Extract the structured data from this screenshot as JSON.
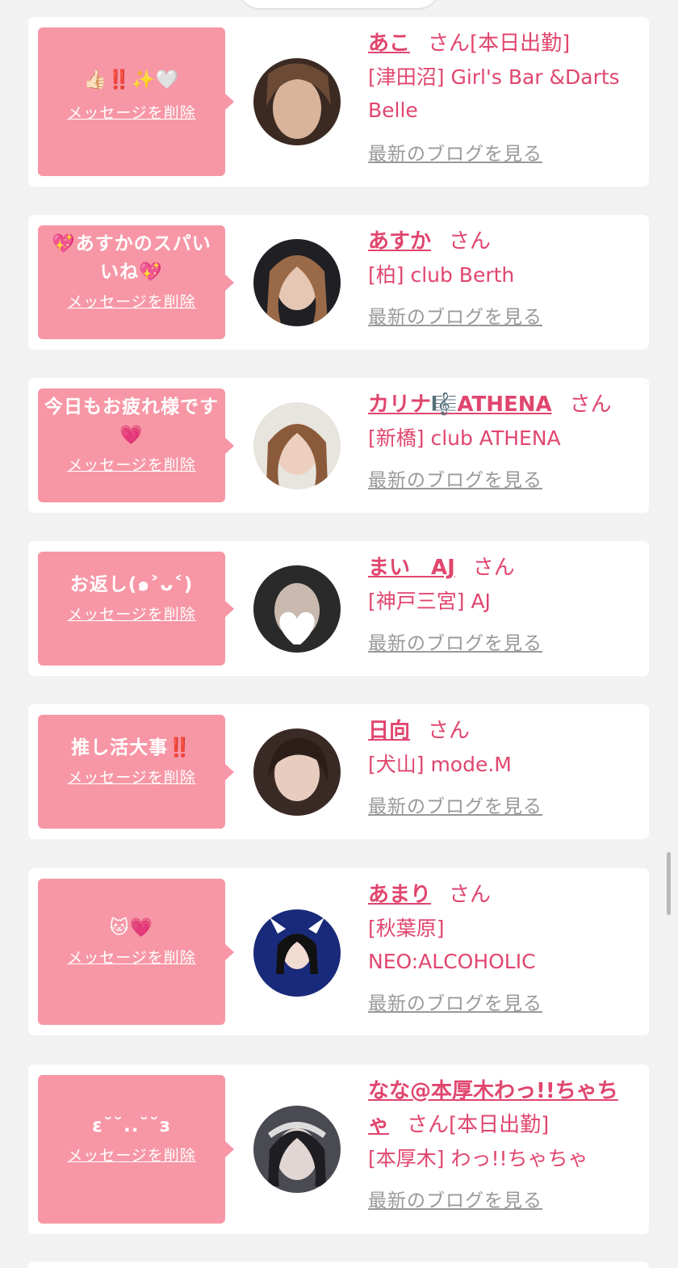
{
  "items": [
    {
      "message": "👍🏻‼️✨🤍",
      "delete_label": "メッセージを削除",
      "name": "あこ",
      "san": "さん",
      "status": "[本日出勤]",
      "shop": "[津田沼] Girl's Bar &Darts Belle",
      "blog_label": "最新のブログを見る"
    },
    {
      "message": "💖あすかのスパいいね💖",
      "delete_label": "メッセージを削除",
      "name": "あすか",
      "san": "さん",
      "status": "",
      "shop": "[柏] club Berth",
      "blog_label": "最新のブログを見る"
    },
    {
      "message": "今日もお疲れ様です💗",
      "delete_label": "メッセージを削除",
      "name": "カリナ🎼ATHENA",
      "san": "さん",
      "status": "",
      "shop": "[新橋] club ATHENA",
      "blog_label": "最新のブログを見る"
    },
    {
      "message": "お返し(๑˃ᴗ˂)",
      "delete_label": "メッセージを削除",
      "name": "まい　AJ",
      "san": "さん",
      "status": "",
      "shop": "[神戸三宮] AJ",
      "blog_label": "最新のブログを見る"
    },
    {
      "message": "推し活大事‼️",
      "delete_label": "メッセージを削除",
      "name": "日向",
      "san": "さん",
      "status": "",
      "shop": "[犬山] mode.M",
      "blog_label": "最新のブログを見る"
    },
    {
      "message": "🐱💗",
      "delete_label": "メッセージを削除",
      "name": "あまり",
      "san": "さん",
      "status": "",
      "shop": "[秋葉原] NEO:ALCOHOLIC",
      "blog_label": "最新のブログを見る"
    },
    {
      "message": "ε˘˘..˘˘з",
      "delete_label": "メッセージを削除",
      "name": "なな@本厚木わっ!!ちゃちゃ",
      "san": "さん",
      "status": "[本日出勤]",
      "shop": "[本厚木] わっ!!ちゃちゃ",
      "blog_label": "最新のブログを見る"
    }
  ]
}
